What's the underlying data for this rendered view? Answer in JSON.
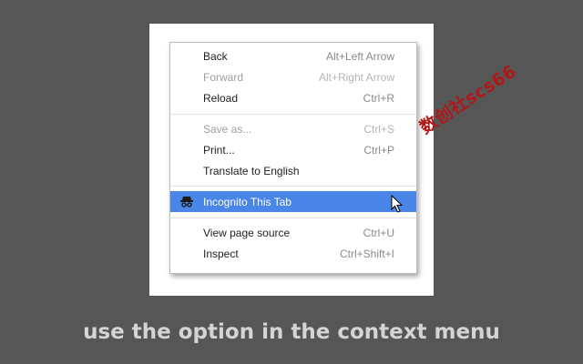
{
  "context_menu": {
    "items": [
      {
        "label": "Back",
        "shortcut": "Alt+Left Arrow",
        "enabled": true
      },
      {
        "label": "Forward",
        "shortcut": "Alt+Right Arrow",
        "enabled": false
      },
      {
        "label": "Reload",
        "shortcut": "Ctrl+R",
        "enabled": true
      },
      {
        "label": "Save as...",
        "shortcut": "Ctrl+S",
        "enabled": false
      },
      {
        "label": "Print...",
        "shortcut": "Ctrl+P",
        "enabled": true
      },
      {
        "label": "Translate to English",
        "shortcut": "",
        "enabled": true
      },
      {
        "label": "Incognito This Tab",
        "shortcut": "",
        "enabled": true,
        "highlighted": true,
        "icon": "incognito-icon"
      },
      {
        "label": "View page source",
        "shortcut": "Ctrl+U",
        "enabled": true
      },
      {
        "label": "Inspect",
        "shortcut": "Ctrl+Shift+I",
        "enabled": true
      }
    ]
  },
  "highlight_color": "#4a86e8",
  "watermark": "数创社scs66",
  "caption": "use the option in the context menu"
}
